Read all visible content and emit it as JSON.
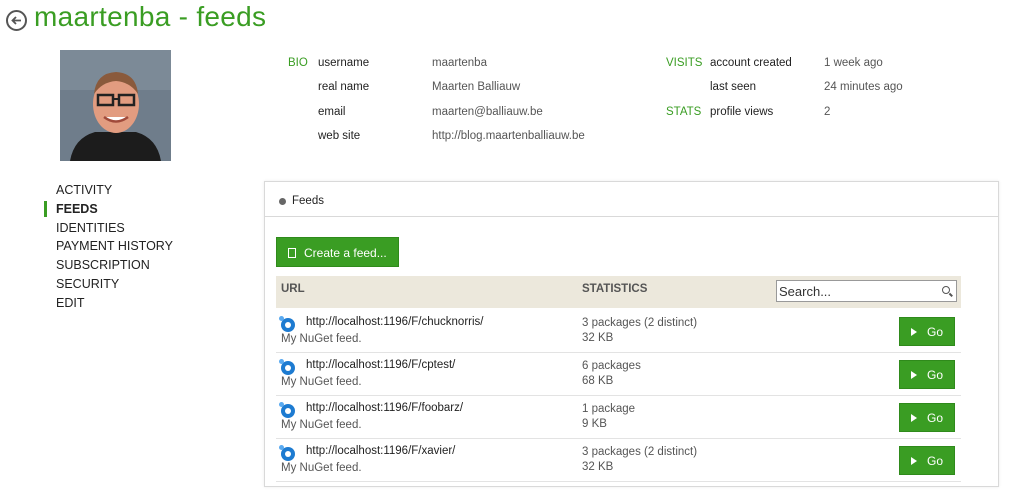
{
  "header": {
    "title": "maartenba - feeds"
  },
  "profile": {
    "bio_label": "BIO",
    "visits_label": "VISITS",
    "stats_label": "STATS",
    "fields": [
      {
        "label": "username",
        "value": "maartenba"
      },
      {
        "label": "real name",
        "value": "Maarten Balliauw"
      },
      {
        "label": "email",
        "value": "maarten@balliauw.be"
      },
      {
        "label": "web site",
        "value": "http://blog.maartenballiauw.be"
      }
    ],
    "visits": [
      {
        "label": "account created",
        "value": "1 week ago"
      },
      {
        "label": "last seen",
        "value": "24 minutes ago"
      }
    ],
    "stats": [
      {
        "label": "profile views",
        "value": "2"
      }
    ]
  },
  "sidebar": {
    "active_index": 1,
    "items": [
      {
        "label": "ACTIVITY"
      },
      {
        "label": "FEEDS"
      },
      {
        "label": "IDENTITIES"
      },
      {
        "label": "PAYMENT HISTORY"
      },
      {
        "label": "SUBSCRIPTION"
      },
      {
        "label": "SECURITY"
      },
      {
        "label": "EDIT"
      }
    ]
  },
  "feeds_panel": {
    "title": "Feeds",
    "create_label": "Create a feed...",
    "columns": {
      "url": "URL",
      "statistics": "STATISTICS"
    },
    "search": {
      "placeholder": "Search..."
    },
    "go_label": "Go",
    "rows": [
      {
        "url": "http://localhost:1196/F/chucknorris/",
        "description": "My NuGet feed.",
        "packages": "3 packages (2 distinct)",
        "size": "32 KB"
      },
      {
        "url": "http://localhost:1196/F/cptest/",
        "description": "My NuGet feed.",
        "packages": "6 packages",
        "size": "68 KB"
      },
      {
        "url": "http://localhost:1196/F/foobarz/",
        "description": "My NuGet feed.",
        "packages": "1 package",
        "size": "9 KB"
      },
      {
        "url": "http://localhost:1196/F/xavier/",
        "description": "My NuGet feed.",
        "packages": "3 packages (2 distinct)",
        "size": "32 KB"
      }
    ]
  },
  "colors": {
    "accent": "#3a9d23",
    "table_header_bg": "#ece8dc",
    "feed_icon": "#1d7bd1"
  }
}
